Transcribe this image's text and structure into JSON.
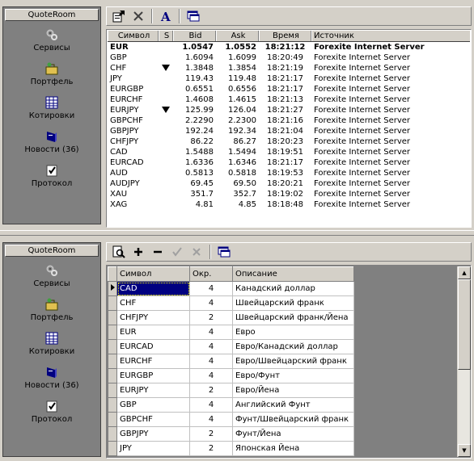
{
  "top_pane": {
    "sidebar": {
      "title": "QuoteRoom",
      "items": [
        {
          "label": "Сервисы",
          "icon": "services-icon"
        },
        {
          "label": "Портфель",
          "icon": "portfolio-icon"
        },
        {
          "label": "Котировки",
          "icon": "quotes-icon"
        },
        {
          "label": "Новости (36)",
          "icon": "news-icon"
        },
        {
          "label": "Протокол",
          "icon": "protocol-icon"
        }
      ]
    },
    "toolbar": [
      "properties-icon",
      "delete-icon",
      "font-icon",
      "window-icon"
    ],
    "quotes": {
      "columns": [
        "Символ",
        "S",
        "Bid",
        "Ask",
        "Время",
        "Источник"
      ],
      "rows": [
        {
          "sym": "EUR",
          "s": "",
          "bid": "1.0547",
          "ask": "1.0552",
          "time": "18:21:12",
          "src": "Forexite Internet Server",
          "bold": true
        },
        {
          "sym": "GBP",
          "s": "",
          "bid": "1.6094",
          "ask": "1.6099",
          "time": "18:20:49",
          "src": "Forexite Internet Server"
        },
        {
          "sym": "CHF",
          "s": "down",
          "bid": "1.3848",
          "ask": "1.3854",
          "time": "18:21:19",
          "src": "Forexite Internet Server"
        },
        {
          "sym": "JPY",
          "s": "",
          "bid": "119.43",
          "ask": "119.48",
          "time": "18:21:17",
          "src": "Forexite Internet Server"
        },
        {
          "sym": "EURGBP",
          "s": "",
          "bid": "0.6551",
          "ask": "0.6556",
          "time": "18:21:17",
          "src": "Forexite Internet Server"
        },
        {
          "sym": "EURCHF",
          "s": "",
          "bid": "1.4608",
          "ask": "1.4615",
          "time": "18:21:13",
          "src": "Forexite Internet Server"
        },
        {
          "sym": "EURJPY",
          "s": "down",
          "bid": "125.99",
          "ask": "126.04",
          "time": "18:21:27",
          "src": "Forexite Internet Server"
        },
        {
          "sym": "GBPCHF",
          "s": "",
          "bid": "2.2290",
          "ask": "2.2300",
          "time": "18:21:16",
          "src": "Forexite Internet Server"
        },
        {
          "sym": "GBPJPY",
          "s": "",
          "bid": "192.24",
          "ask": "192.34",
          "time": "18:21:04",
          "src": "Forexite Internet Server"
        },
        {
          "sym": "CHFJPY",
          "s": "",
          "bid": "86.22",
          "ask": "86.27",
          "time": "18:20:23",
          "src": "Forexite Internet Server"
        },
        {
          "sym": "CAD",
          "s": "",
          "bid": "1.5488",
          "ask": "1.5494",
          "time": "18:19:51",
          "src": "Forexite Internet Server"
        },
        {
          "sym": "EURCAD",
          "s": "",
          "bid": "1.6336",
          "ask": "1.6346",
          "time": "18:21:17",
          "src": "Forexite Internet Server"
        },
        {
          "sym": "AUD",
          "s": "",
          "bid": "0.5813",
          "ask": "0.5818",
          "time": "18:19:53",
          "src": "Forexite Internet Server"
        },
        {
          "sym": "AUDJPY",
          "s": "",
          "bid": "69.45",
          "ask": "69.50",
          "time": "18:20:21",
          "src": "Forexite Internet Server"
        },
        {
          "sym": "XAU",
          "s": "",
          "bid": "351.7",
          "ask": "352.7",
          "time": "18:19:02",
          "src": "Forexite Internet Server"
        },
        {
          "sym": "XAG",
          "s": "",
          "bid": "4.81",
          "ask": "4.85",
          "time": "18:18:48",
          "src": "Forexite Internet Server"
        }
      ]
    }
  },
  "bottom_pane": {
    "sidebar": {
      "title": "QuoteRoom",
      "items": [
        {
          "label": "Сервисы",
          "icon": "services-icon"
        },
        {
          "label": "Портфель",
          "icon": "portfolio-icon"
        },
        {
          "label": "Котировки",
          "icon": "quotes-icon"
        },
        {
          "label": "Новости (36)",
          "icon": "news-icon"
        },
        {
          "label": "Протокол",
          "icon": "protocol-icon"
        }
      ]
    },
    "toolbar": [
      "preview-icon",
      "add-icon",
      "remove-icon",
      "confirm-icon",
      "cancel-icon",
      "window-icon"
    ],
    "symbols": {
      "columns": [
        "Символ",
        "Окр.",
        "Описание"
      ],
      "rows": [
        {
          "sym": "CAD",
          "okr": "4",
          "desc": "Канадский доллар",
          "selected": true
        },
        {
          "sym": "CHF",
          "okr": "4",
          "desc": "Швейцарский франк"
        },
        {
          "sym": "CHFJPY",
          "okr": "2",
          "desc": "Швейцарский франк/Йена"
        },
        {
          "sym": "EUR",
          "okr": "4",
          "desc": "Евро"
        },
        {
          "sym": "EURCAD",
          "okr": "4",
          "desc": "Евро/Канадский доллар"
        },
        {
          "sym": "EURCHF",
          "okr": "4",
          "desc": "Евро/Швейцарский франк"
        },
        {
          "sym": "EURGBP",
          "okr": "4",
          "desc": "Евро/Фунт"
        },
        {
          "sym": "EURJPY",
          "okr": "2",
          "desc": "Евро/Йена"
        },
        {
          "sym": "GBP",
          "okr": "4",
          "desc": "Английский Фунт"
        },
        {
          "sym": "GBPCHF",
          "okr": "4",
          "desc": "Фунт/Швейцарский франк"
        },
        {
          "sym": "GBPJPY",
          "okr": "2",
          "desc": "Фунт/Йена"
        },
        {
          "sym": "JPY",
          "okr": "2",
          "desc": "Японская Йена"
        }
      ]
    }
  }
}
